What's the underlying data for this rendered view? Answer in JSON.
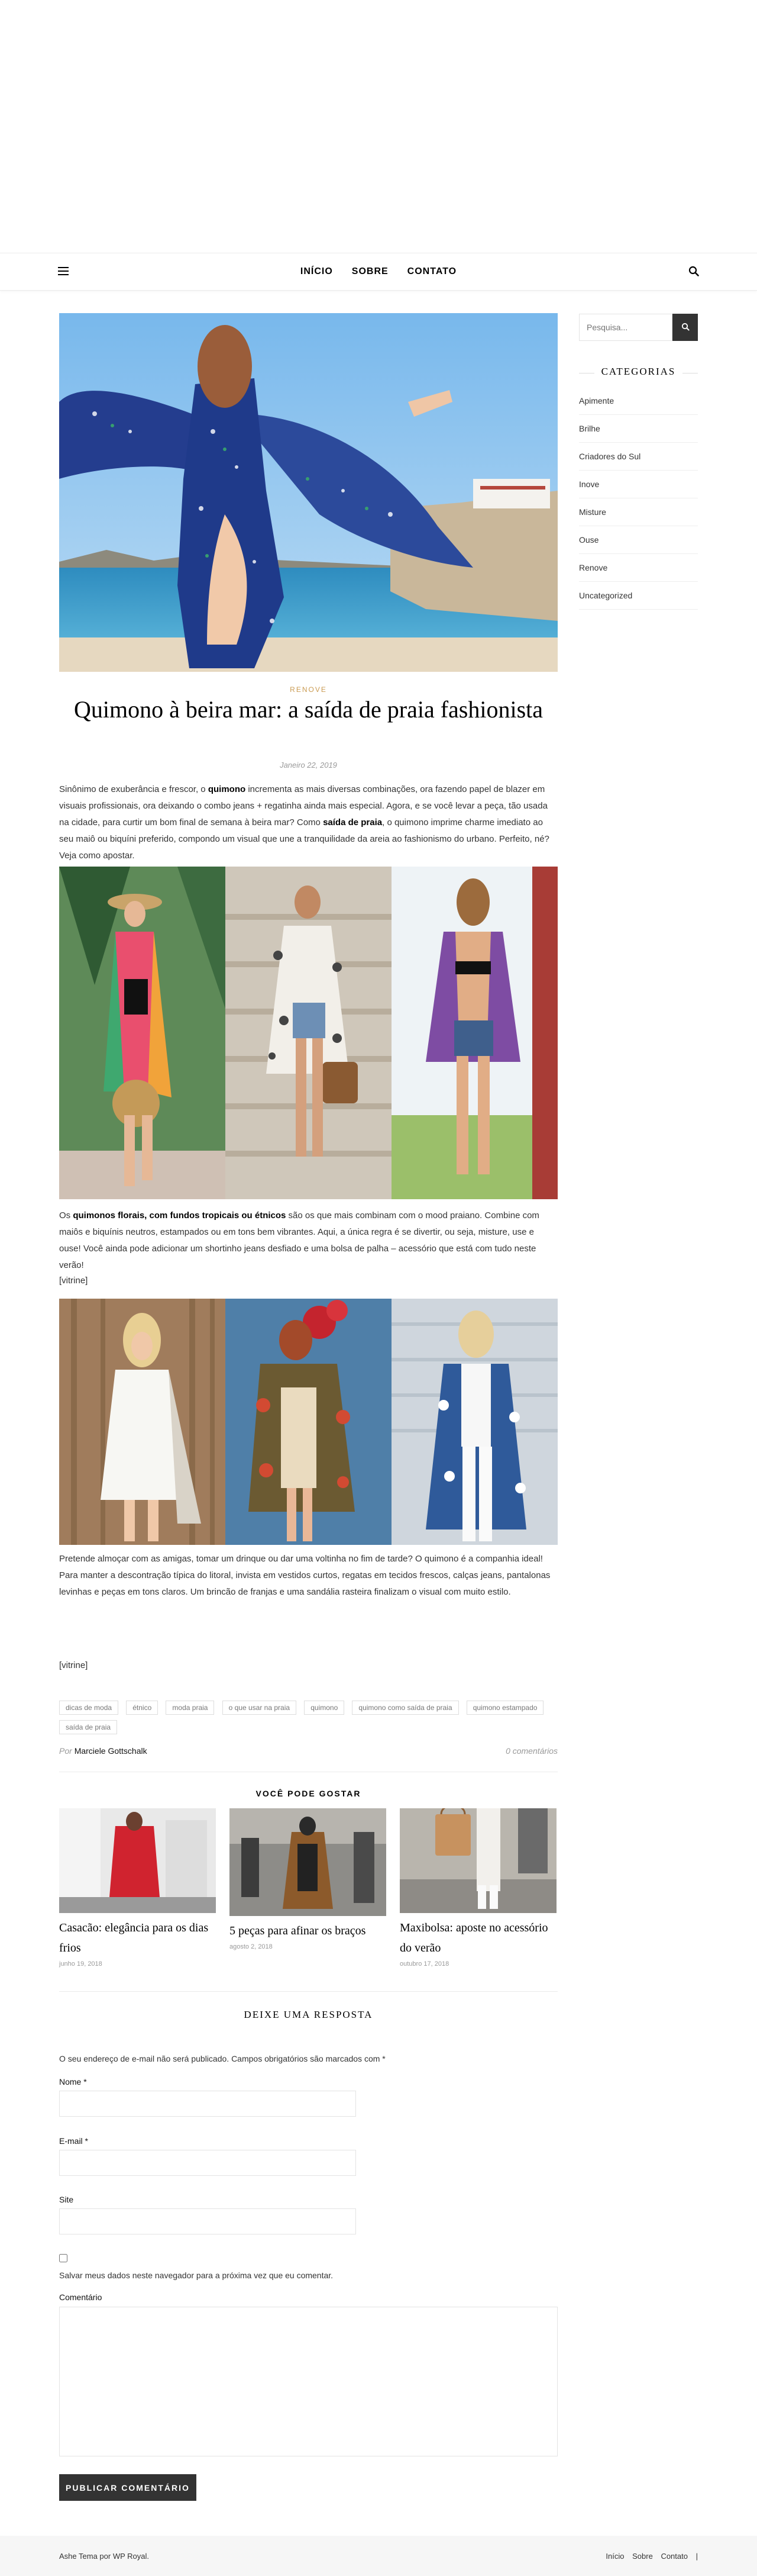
{
  "nav": {
    "items": [
      "INÍCIO",
      "SOBRE",
      "CONTATO"
    ]
  },
  "post": {
    "category": "RENOVE",
    "title": "Quimono à beira mar: a saída de praia fashionista",
    "date": "Janeiro 22, 2019",
    "intro": {
      "t1": "Sinônimo de exuberância e frescor, o ",
      "b1": "quimono",
      "t2": " incrementa as mais diversas combinações, ora fazendo papel de blazer em visuais profissionais, ora deixando o combo jeans + regatinha ainda mais especial. Agora, e se você levar a peça, tão usada na cidade, para curtir um bom final de semana à beira mar? Como ",
      "b2": "saída de praia",
      "t3": ", o quimono imprime charme imediato ao seu maiô ou biquíni preferido, compondo um visual que une a tranquilidade da areia ao fashionismo do urbano. Perfeito, né? Veja como apostar."
    },
    "para2": {
      "t1": "Os ",
      "b1": "quimonos florais, com fundos tropicais ou étnicos",
      "t2": " são os que mais combinam com o mood praiano. Combine com maiôs e biquínis neutros, estampados ou em tons bem vibrantes. Aqui, a única regra é se divertir, ou seja, misture, use e ouse! Você ainda pode adicionar um shortinho jeans desfiado e uma bolsa de palha – acessório que está com tudo neste verão!"
    },
    "vitrine1": "[vitrine]",
    "para3": "Pretende almoçar com as amigas, tomar um drinque ou dar uma voltinha no fim de tarde? O quimono é a companhia ideal! Para manter a descontração típica do litoral, invista em vestidos curtos, regatas em tecidos frescos, calças jeans, pantalonas levinhas e peças em tons claros. Um brincão de franjas e uma sandália rasteira finalizam o visual com muito estilo.",
    "vitrine2": "[vitrine]",
    "tags": [
      "dicas de moda",
      "étnico",
      "moda praia",
      "o que usar na praia",
      "quimono",
      "quimono como saída de praia",
      "quimono estampado",
      "saída de praia"
    ],
    "author_prefix": "Por",
    "author": "Marciele Gottschalk",
    "comments": "0 comentários"
  },
  "related": {
    "title": "VOCÊ PODE GOSTAR",
    "items": [
      {
        "title": "Casacão: elegância para os dias frios",
        "date": "junho 19, 2018"
      },
      {
        "title": "5 peças para afinar os braços",
        "date": "agosto 2, 2018"
      },
      {
        "title": "Maxibolsa: aposte no acessório do verão",
        "date": "outubro 17, 2018"
      }
    ]
  },
  "reply": {
    "title": "DEIXE UMA RESPOSTA",
    "note": "O seu endereço de e-mail não será publicado. Campos obrigatórios são marcados com *",
    "name_label": "Nome *",
    "email_label": "E-mail *",
    "site_label": "Site",
    "save_label": "Salvar meus dados neste navegador para a próxima vez que eu comentar.",
    "comment_label": "Comentário",
    "submit": "PUBLICAR COMENTÁRIO"
  },
  "sidebar": {
    "search_placeholder": "Pesquisa...",
    "categories_title": "CATEGORIAS",
    "categories": [
      "Apimente",
      "Brilhe",
      "Criadores do Sul",
      "Inove",
      "Misture",
      "Ouse",
      "Renove",
      "Uncategorized"
    ]
  },
  "footer": {
    "credit_prefix": "Ashe Tema por ",
    "credit_link": "WP Royal",
    "credit_suffix": ".",
    "menu": [
      "Início",
      "Sobre",
      "Contato"
    ],
    "separator": "|"
  },
  "colors": {
    "accent": "#ca9b52",
    "button": "#333333",
    "footer_bg": "#f6f6f6"
  }
}
